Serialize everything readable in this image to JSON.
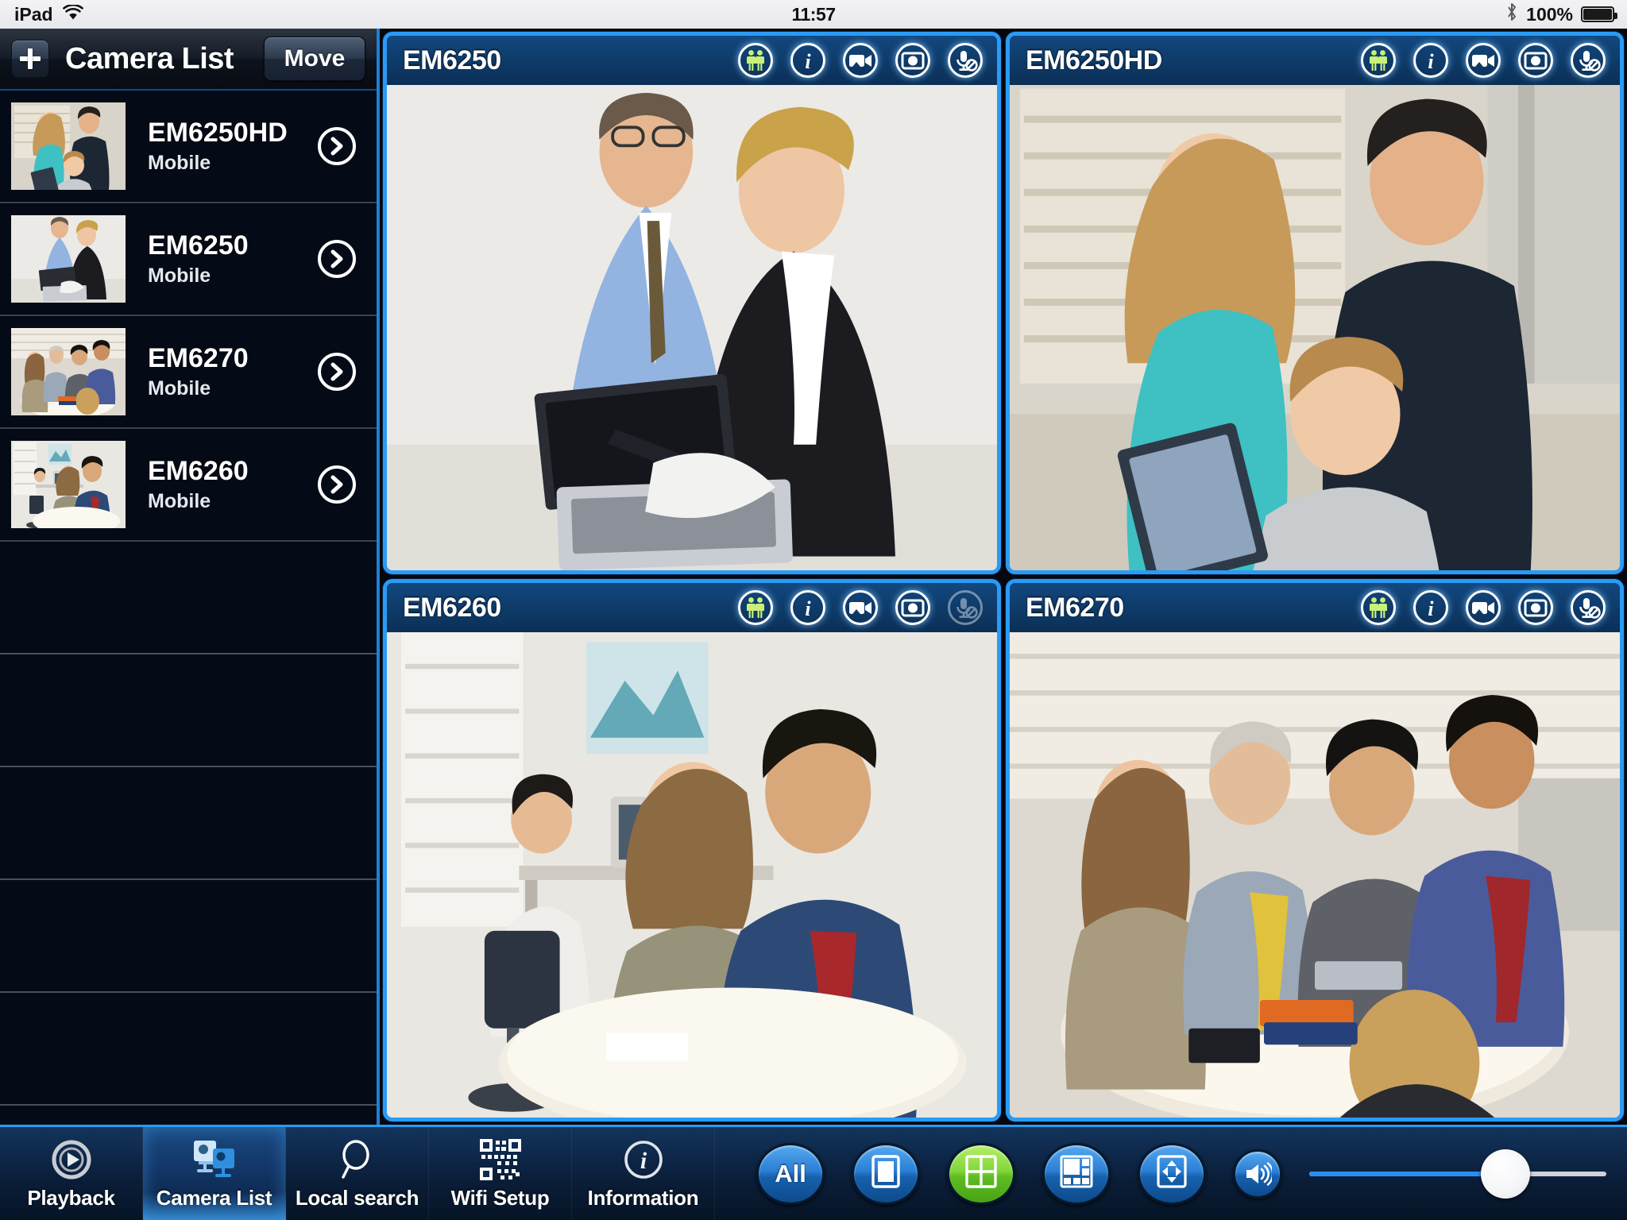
{
  "status_bar": {
    "device": "iPad",
    "wifi_icon": "wifi-icon",
    "time": "11:57",
    "bluetooth_icon": "bluetooth-icon",
    "battery_percent": "100%",
    "battery_icon": "battery-full-icon"
  },
  "sidebar": {
    "add_icon": "plus-icon",
    "title": "Camera List",
    "move_label": "Move",
    "cameras": [
      {
        "name": "EM6250HD",
        "status": "Mobile",
        "thumb": "family-sofa-thumb",
        "chevron": "chevron-right-icon"
      },
      {
        "name": "EM6250",
        "status": "Mobile",
        "thumb": "office-laptop-thumb",
        "chevron": "chevron-right-icon"
      },
      {
        "name": "EM6270",
        "status": "Mobile",
        "thumb": "meeting-table-thumb",
        "chevron": "chevron-right-icon"
      },
      {
        "name": "EM6260",
        "status": "Mobile",
        "thumb": "office-desk-thumb",
        "chevron": "chevron-right-icon"
      }
    ],
    "empty_rows": 5
  },
  "grid": {
    "panels": [
      {
        "title": "EM6250",
        "scene": "two-colleagues-laptop",
        "icons": [
          {
            "name": "motion-detection-icon",
            "state": "active"
          },
          {
            "name": "info-icon",
            "state": "normal"
          },
          {
            "name": "video-record-icon",
            "state": "normal"
          },
          {
            "name": "snapshot-icon",
            "state": "normal"
          },
          {
            "name": "microphone-muted-icon",
            "state": "normal"
          }
        ]
      },
      {
        "title": "EM6250HD",
        "scene": "family-on-sofa",
        "icons": [
          {
            "name": "motion-detection-icon",
            "state": "active"
          },
          {
            "name": "info-icon",
            "state": "normal"
          },
          {
            "name": "video-record-icon",
            "state": "normal"
          },
          {
            "name": "snapshot-icon",
            "state": "normal"
          },
          {
            "name": "microphone-muted-icon",
            "state": "normal"
          }
        ]
      },
      {
        "title": "EM6260",
        "scene": "office-consultation",
        "icons": [
          {
            "name": "motion-detection-icon",
            "state": "active"
          },
          {
            "name": "info-icon",
            "state": "normal"
          },
          {
            "name": "video-record-icon",
            "state": "normal"
          },
          {
            "name": "snapshot-icon",
            "state": "normal"
          },
          {
            "name": "microphone-muted-icon",
            "state": "disabled"
          }
        ]
      },
      {
        "title": "EM6270",
        "scene": "boardroom-meeting",
        "icons": [
          {
            "name": "motion-detection-icon",
            "state": "active"
          },
          {
            "name": "info-icon",
            "state": "normal"
          },
          {
            "name": "video-record-icon",
            "state": "normal"
          },
          {
            "name": "snapshot-icon",
            "state": "normal"
          },
          {
            "name": "microphone-muted-icon",
            "state": "normal"
          }
        ]
      }
    ]
  },
  "toolbar": {
    "tabs": [
      {
        "label": "Playback",
        "icon": "playback-icon",
        "active": false
      },
      {
        "label": "Camera List",
        "icon": "camera-list-icon",
        "active": true
      },
      {
        "label": "Local search",
        "icon": "search-icon",
        "active": false
      },
      {
        "label": "Wifi Setup",
        "icon": "qr-code-icon",
        "active": false
      },
      {
        "label": "Information",
        "icon": "info-icon",
        "active": false
      }
    ],
    "layout_buttons": [
      {
        "name": "all-channels-button",
        "label": "All",
        "icon": "text-all",
        "active": false
      },
      {
        "name": "single-view-button",
        "label": "",
        "icon": "layout-1-icon",
        "active": false
      },
      {
        "name": "quad-view-button",
        "label": "",
        "icon": "layout-4-icon",
        "active": true
      },
      {
        "name": "six-view-button",
        "label": "",
        "icon": "layout-6-icon",
        "active": false
      },
      {
        "name": "fullscreen-button",
        "label": "",
        "icon": "expand-arrows-icon",
        "active": false
      }
    ],
    "volume": {
      "icon": "speaker-icon",
      "level_percent": 66
    }
  },
  "colors": {
    "accent_blue": "#2a9bf5",
    "panel_header": "#0e3a68",
    "active_green": "#81d63a",
    "sidebar_bg": "#050b16"
  }
}
